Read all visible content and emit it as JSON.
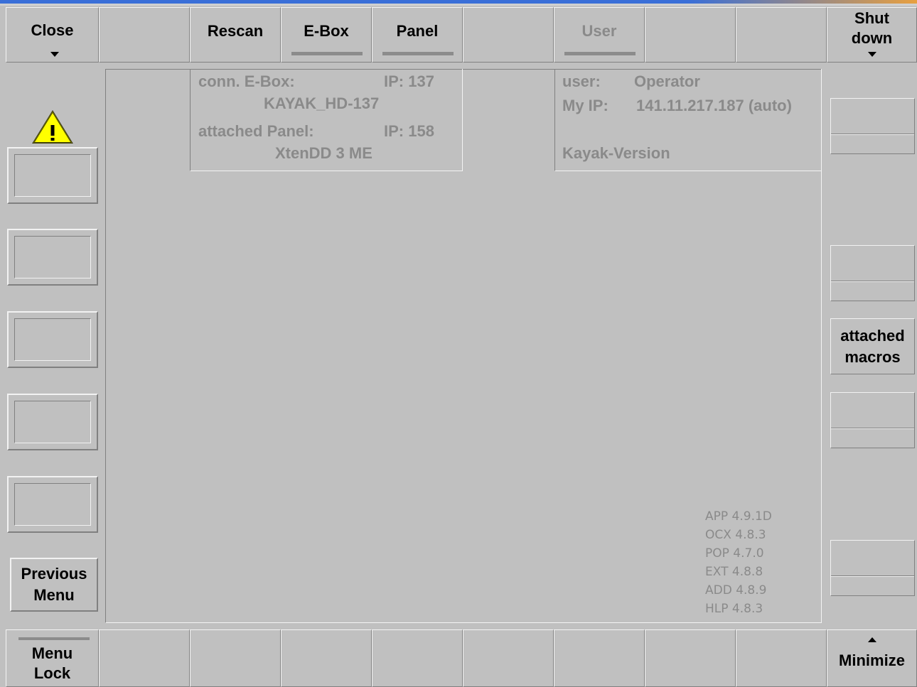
{
  "colors": {
    "background": "#c0c0c0",
    "disabled_text": "#8a8a8a",
    "warning_fill": "#ffff00",
    "accent_start": "#3a6fd8",
    "accent_end": "#e8a040"
  },
  "top_bar": {
    "close": "Close",
    "rescan": "Rescan",
    "ebox": "E-Box",
    "panel": "Panel",
    "user": "User",
    "shutdown_line1": "Shut",
    "shutdown_line2": "down"
  },
  "left_column": {
    "warning_icon": "warning-triangle",
    "previous_menu_line1": "Previous",
    "previous_menu_line2": "Menu"
  },
  "right_column": {
    "attached_macros_line1": "attached",
    "attached_macros_line2": "macros"
  },
  "connection_info": {
    "ebox_label": "conn. E-Box:",
    "ebox_ip": "IP: 137",
    "ebox_name": "KAYAK_HD-137",
    "panel_label": "attached Panel:",
    "panel_ip": "IP: 158",
    "panel_name": "XtenDD 3 ME"
  },
  "user_info": {
    "user_label": "user:",
    "user_value": "Operator",
    "myip_label": "My IP:",
    "myip_value": "141.11.217.187 (auto)",
    "version_label": "Kayak-Version"
  },
  "versions": [
    "APP 4.9.1D",
    "OCX 4.8.3",
    "POP 4.7.0",
    "EXT 4.8.8",
    "ADD 4.8.9",
    "HLP 4.8.3"
  ],
  "bottom_bar": {
    "menu_lock_line1": "Menu",
    "menu_lock_line2": "Lock",
    "minimize": "Minimize"
  }
}
